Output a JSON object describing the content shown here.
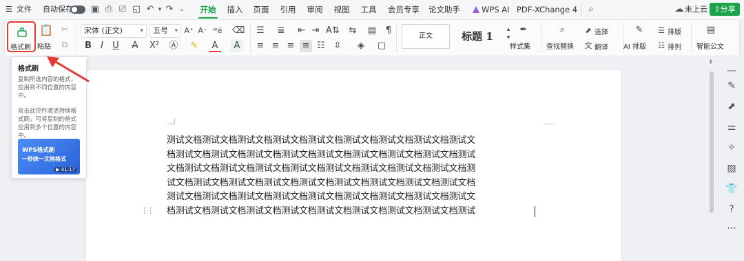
{
  "menubar": {
    "file_label": "文件",
    "autosave_label": "自动保存",
    "tabs": [
      "开始",
      "插入",
      "页面",
      "引用",
      "审阅",
      "视图",
      "工具",
      "会员专享",
      "论文助手",
      "WPS AI",
      "PDF-XChange 4"
    ],
    "cloud_label": "未上云",
    "share_label": "分享"
  },
  "ribbon": {
    "format_painter_label": "格式刷",
    "paste_label": "粘贴",
    "font_name": "宋体 (正文)",
    "font_size": "五号",
    "style_normal": "正文",
    "style_heading": "标题 1",
    "style_set_label": "样式集",
    "find_replace_label": "查找替换",
    "select_label": "选择",
    "translate_label": "翻译",
    "ai_layout_label": "AI 排版",
    "layout_label": "排版",
    "arrange_label": "排列",
    "smart_doc_label": "智能公文"
  },
  "tooltip": {
    "title": "格式刷",
    "desc1": "复制所选内容的格式，应用到不同位置的内容中。",
    "desc2": "双击此控件激活持续格式刷，可将复制的格式应用到多个位置的内容中。",
    "video_line1": "WPS格式刷",
    "video_line2": "一秒统一文档格式",
    "video_time": "01:17"
  },
  "document": {
    "lines": [
      "测试文档测试文档测试文档测试文档测试文档测试文档测试文档测试文档测试文",
      "档测试文档测试文档测试文档测试文档测试文档测试文档测试文档测试文档测试",
      "文档测试文档测试文档测试文档测试文档测试文档测试文档测试文档测试文档测",
      "试文档测试文档测试文档测试文档测试文档测试文档测试文档测试文档测试文档",
      "测试文档测试文档测试文档测试文档测试文档测试文档测试文档测试文档测试文",
      "档测试文档测试文档测试文档测试文档测试文档测试文档测试文档测试文档测试"
    ]
  },
  "colors": {
    "accent": "#1aa34a",
    "highlight_box": "#e53935",
    "arrow": "#e53935"
  }
}
